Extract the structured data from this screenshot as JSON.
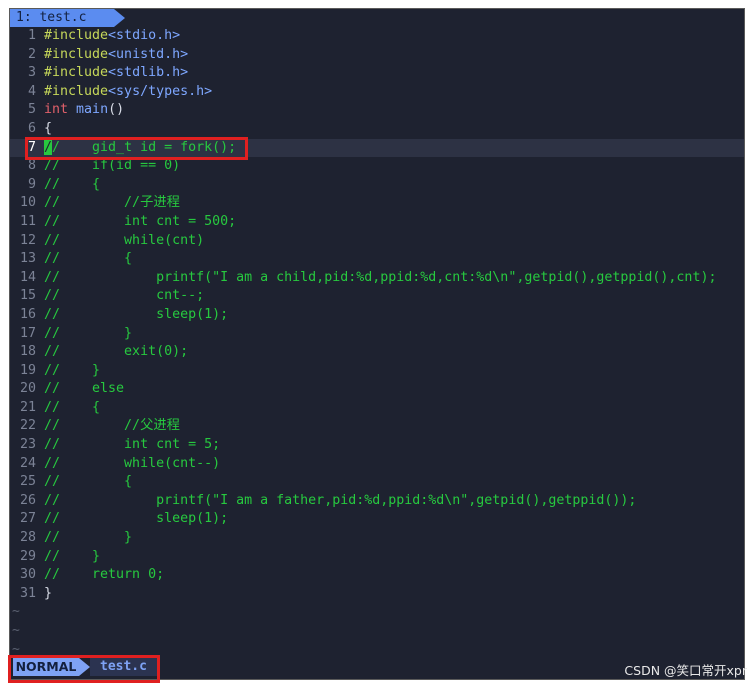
{
  "tab": {
    "label": "1: test.c"
  },
  "code_lines": [
    {
      "num": "1",
      "html": "<span class=\"pp\">#include</span><span class=\"inc\">&lt;stdio.h&gt;</span>"
    },
    {
      "num": "2",
      "html": "<span class=\"pp\">#include</span><span class=\"inc\">&lt;unistd.h&gt;</span>"
    },
    {
      "num": "3",
      "html": "<span class=\"pp\">#include</span><span class=\"inc\">&lt;stdlib.h&gt;</span>"
    },
    {
      "num": "4",
      "html": "<span class=\"pp\">#include</span><span class=\"inc\">&lt;sys/types.h&gt;</span>"
    },
    {
      "num": "5",
      "html": "<span class=\"kw\">int</span> <span class=\"fn\">main</span><span class=\"brace\">()</span>"
    },
    {
      "num": "6",
      "html": "<span class=\"brace\">{</span>"
    },
    {
      "num": "7",
      "html": "<span class=\"cmt\"><span class=\"cursorchar\">/</span>/    gid_t id = fork();</span>",
      "current": true
    },
    {
      "num": "8",
      "html": "<span class=\"cmt\">//    if(id == 0)</span>"
    },
    {
      "num": "9",
      "html": "<span class=\"cmt\">//    {</span>"
    },
    {
      "num": "10",
      "html": "<span class=\"cmt\">//        //子进程</span>"
    },
    {
      "num": "11",
      "html": "<span class=\"cmt\">//        int cnt = 500;</span>"
    },
    {
      "num": "12",
      "html": "<span class=\"cmt\">//        while(cnt)</span>"
    },
    {
      "num": "13",
      "html": "<span class=\"cmt\">//        {</span>"
    },
    {
      "num": "14",
      "html": "<span class=\"cmt\">//            printf(\"I am a child,pid:%d,ppid:%d,cnt:%d\\n\",getpid(),getppid(),cnt);</span>"
    },
    {
      "num": "15",
      "html": "<span class=\"cmt\">//            cnt--;</span>"
    },
    {
      "num": "16",
      "html": "<span class=\"cmt\">//            sleep(1);</span>"
    },
    {
      "num": "17",
      "html": "<span class=\"cmt\">//        }</span>"
    },
    {
      "num": "18",
      "html": "<span class=\"cmt\">//        exit(0);</span>"
    },
    {
      "num": "19",
      "html": "<span class=\"cmt\">//    }</span>"
    },
    {
      "num": "20",
      "html": "<span class=\"cmt\">//    else</span>"
    },
    {
      "num": "21",
      "html": "<span class=\"cmt\">//    {</span>"
    },
    {
      "num": "22",
      "html": "<span class=\"cmt\">//        //父进程</span>"
    },
    {
      "num": "23",
      "html": "<span class=\"cmt\">//        int cnt = 5;</span>"
    },
    {
      "num": "24",
      "html": "<span class=\"cmt\">//        while(cnt--)</span>"
    },
    {
      "num": "25",
      "html": "<span class=\"cmt\">//        {</span>"
    },
    {
      "num": "26",
      "html": "<span class=\"cmt\">//            printf(\"I am a father,pid:%d,ppid:%d\\n\",getpid(),getppid());</span>"
    },
    {
      "num": "27",
      "html": "<span class=\"cmt\">//            sleep(1);</span>"
    },
    {
      "num": "28",
      "html": "<span class=\"cmt\">//        }</span>"
    },
    {
      "num": "29",
      "html": "<span class=\"cmt\">//    }</span>"
    },
    {
      "num": "30",
      "html": "<span class=\"cmt\">//    return 0;</span>"
    },
    {
      "num": "31",
      "html": "<span class=\"brace\">}</span>"
    }
  ],
  "tilde_lines": [
    "~",
    "~",
    "~"
  ],
  "status": {
    "mode": "NORMAL",
    "filename": "test.c"
  },
  "watermark": "CSDN @笑口常开xpr",
  "colors": {
    "background": "#1e2230",
    "comment": "#27c93f",
    "mode": "#7ea2f4",
    "highlight_box": "#e02020"
  }
}
